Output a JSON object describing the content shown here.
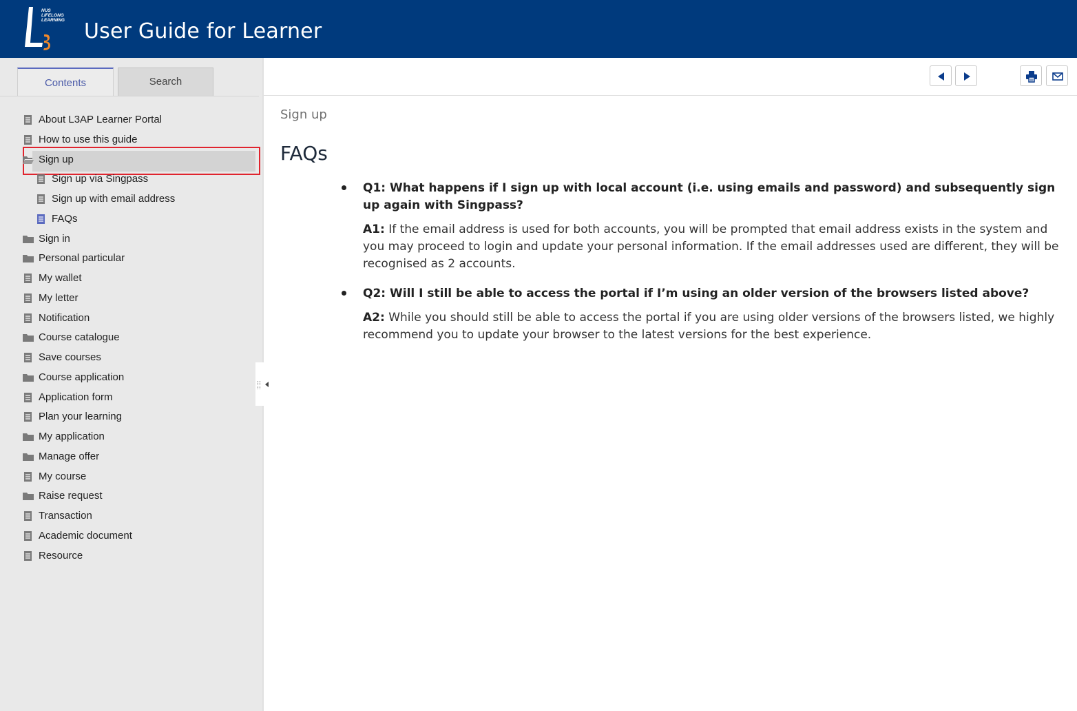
{
  "header": {
    "logo_text": [
      "NUS",
      "LIFELONG",
      "LEARNING"
    ],
    "title": "User Guide for Learner"
  },
  "sidebar": {
    "tabs": [
      {
        "label": "Contents",
        "active": true
      },
      {
        "label": "Search",
        "active": false
      }
    ],
    "items": [
      {
        "label": "About L3AP Learner Portal",
        "icon": "page-icon"
      },
      {
        "label": "How to use this guide",
        "icon": "page-icon"
      },
      {
        "label": "Sign up",
        "icon": "open-folder-icon"
      },
      {
        "label": "Sign up via Singpass",
        "icon": "page-icon"
      },
      {
        "label": "Sign up with email address",
        "icon": "page-icon"
      },
      {
        "label": "FAQs",
        "icon": "page-icon",
        "selected": true
      },
      {
        "label": "Sign in",
        "icon": "folder-icon"
      },
      {
        "label": "Personal particular",
        "icon": "folder-icon"
      },
      {
        "label": "My wallet",
        "icon": "page-icon"
      },
      {
        "label": "My letter",
        "icon": "page-icon"
      },
      {
        "label": "Notification",
        "icon": "page-icon"
      },
      {
        "label": "Course catalogue",
        "icon": "folder-icon"
      },
      {
        "label": "Save courses",
        "icon": "page-icon"
      },
      {
        "label": "Course application",
        "icon": "folder-icon"
      },
      {
        "label": "Application form",
        "icon": "page-icon"
      },
      {
        "label": "Plan your learning",
        "icon": "page-icon"
      },
      {
        "label": "My application",
        "icon": "folder-icon"
      },
      {
        "label": "Manage offer",
        "icon": "folder-icon"
      },
      {
        "label": "My course",
        "icon": "page-icon"
      },
      {
        "label": "Raise request",
        "icon": "folder-icon"
      },
      {
        "label": "Transaction",
        "icon": "page-icon"
      },
      {
        "label": "Academic document",
        "icon": "page-icon"
      },
      {
        "label": "Resource",
        "icon": "page-icon"
      }
    ]
  },
  "toolbar": {
    "buttons": [
      "previous-icon",
      "next-icon",
      "print-icon",
      "email-icon"
    ]
  },
  "content": {
    "breadcrumb": "Sign up",
    "title": "FAQs",
    "faqs": [
      {
        "question": "Q1: What happens if I sign up with local account (i.e. using emails and password) and subsequently sign up again with Singpass?",
        "answer_label": "A1:",
        "answer": "If the email address is used for both accounts, you will be prompted that email address exists in the system and you may proceed to login and update your personal information. If the email addresses used are different, they will be recognised as 2 accounts."
      },
      {
        "question": "Q2: Will I still be able to access the portal if I’m using an older version of the browsers listed above?",
        "answer_label": "A2:",
        "answer": "While you should still be able to access the portal if you are using older versions of the browsers listed, we highly recommend you to update your browser to the latest versions for the best experience."
      }
    ]
  },
  "colors": {
    "header_bg": "#003a7d",
    "logo_accent": "#f0892b",
    "active_tab": "#4a5aa8",
    "highlight_border": "#e0242e",
    "sidebar_bg": "#e9e9e9",
    "selected_page_icon": "#5b6abf"
  }
}
